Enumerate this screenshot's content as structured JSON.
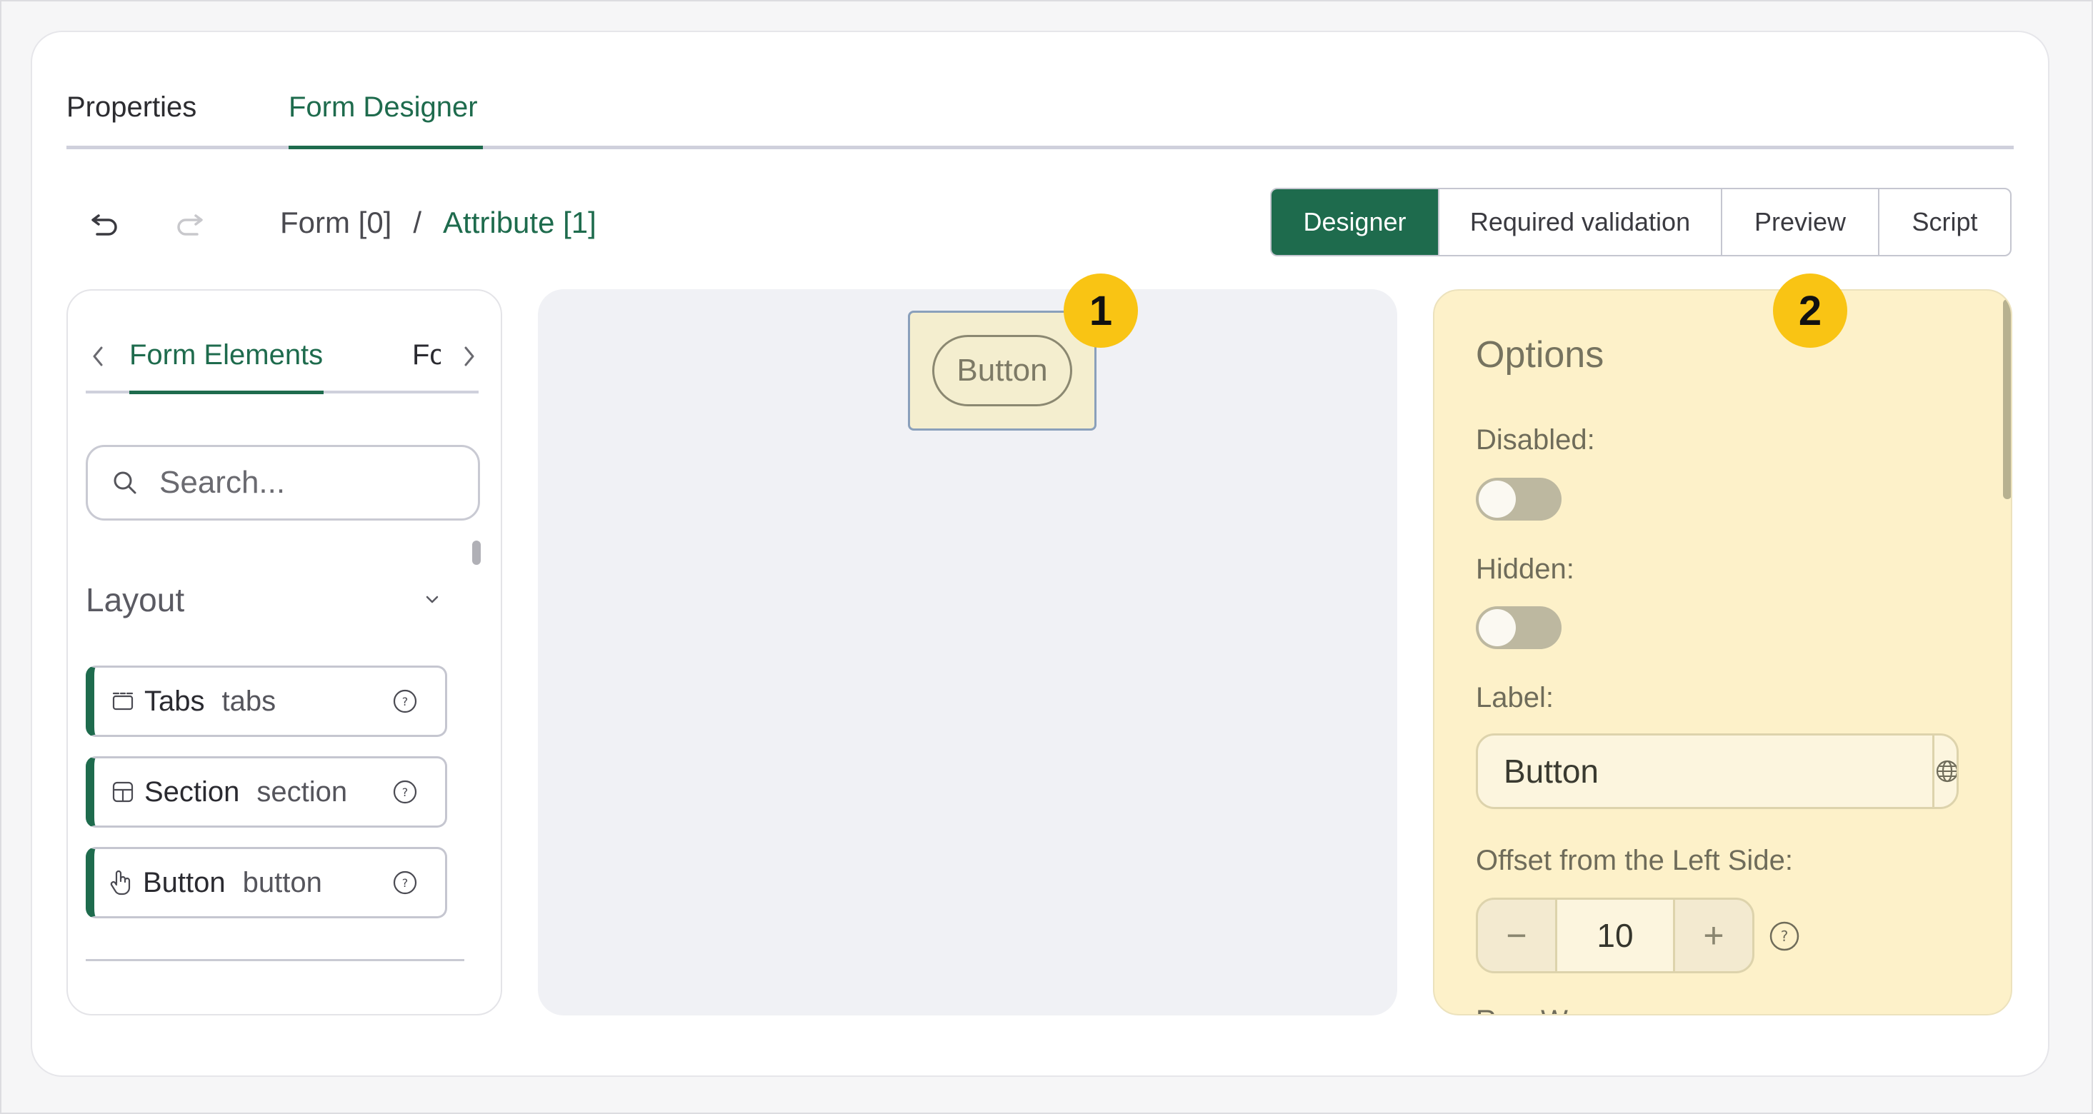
{
  "top_tabs": [
    {
      "label": "Properties",
      "active": false
    },
    {
      "label": "Form Designer",
      "active": true
    }
  ],
  "breadcrumb": {
    "root": "Form [0]",
    "separator": "/",
    "current": "Attribute [1]"
  },
  "mode_tabs": [
    {
      "label": "Designer",
      "active": true
    },
    {
      "label": "Required validation",
      "active": false
    },
    {
      "label": "Preview",
      "active": false
    },
    {
      "label": "Script",
      "active": false
    }
  ],
  "left_panel": {
    "tab_active": "Form Elements",
    "tab_next_partial": "Fo",
    "search_placeholder": "Search...",
    "section_title": "Layout",
    "items": [
      {
        "name": "Tabs",
        "key": "tabs",
        "icon": "tabs-icon"
      },
      {
        "name": "Section",
        "key": "section",
        "icon": "section-icon"
      },
      {
        "name": "Button",
        "key": "button",
        "icon": "pointer-hand-icon"
      }
    ]
  },
  "canvas": {
    "button_label": "Button",
    "badge": "1"
  },
  "options_panel": {
    "badge": "2",
    "title": "Options",
    "disabled_label": "Disabled:",
    "disabled_on": false,
    "hidden_label": "Hidden:",
    "hidden_on": false,
    "label_label": "Label:",
    "label_value": "Button",
    "offset_label": "Offset from the Left Side:",
    "offset_value": "10",
    "minus": "−",
    "plus": "+",
    "next_partial": "Row W"
  },
  "colors": {
    "accent": "#1e6b4d",
    "highlight": "#fdf1c9",
    "badge": "#f9c414"
  }
}
